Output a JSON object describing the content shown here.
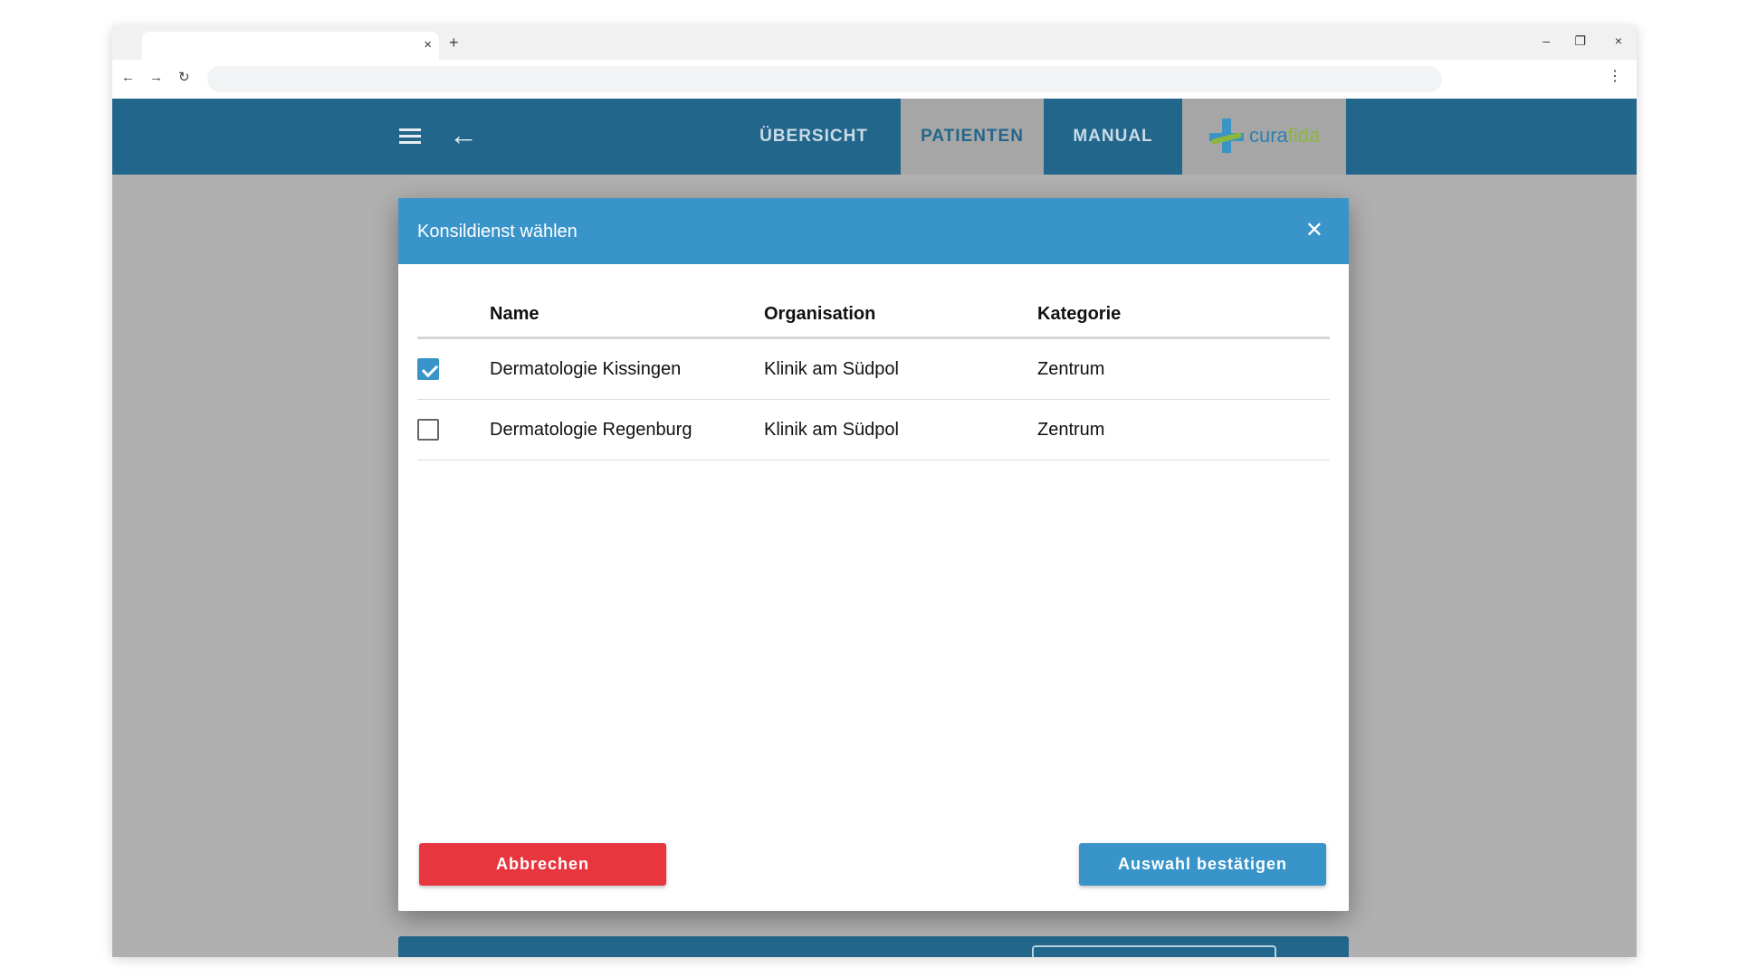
{
  "browser": {
    "tab_close": "×",
    "new_tab": "+",
    "window_controls": {
      "minimize": "–",
      "restore": "❐",
      "close": "×"
    },
    "nav": {
      "back": "←",
      "forward": "→",
      "reload": "↻"
    },
    "menu": "⋮"
  },
  "appbar": {
    "back_icon": "←",
    "tabs": [
      {
        "label": "ÜBERSICHT",
        "active": false
      },
      {
        "label": "PATIENTEN",
        "active": true
      },
      {
        "label": "MANUAL",
        "active": false
      }
    ],
    "logo": {
      "part1": "cura",
      "part2": "fida"
    }
  },
  "dialog": {
    "title": "Konsildienst wählen",
    "close_icon": "✕",
    "columns": [
      "Name",
      "Organisation",
      "Kategorie"
    ],
    "rows": [
      {
        "checked": true,
        "name": "Dermatologie Kissingen",
        "organisation": "Klinik am Südpol",
        "kategorie": "Zentrum"
      },
      {
        "checked": false,
        "name": "Dermatologie Regenburg",
        "organisation": "Klinik am Südpol",
        "kategorie": "Zentrum"
      }
    ],
    "cancel_label": "Abbrechen",
    "confirm_label": "Auswahl bestätigen"
  },
  "colors": {
    "appbar": "#23668b",
    "dialog_header": "#3994c9",
    "cancel": "#e8363f",
    "confirm": "#3994c9",
    "logo_green": "#8db63c"
  }
}
